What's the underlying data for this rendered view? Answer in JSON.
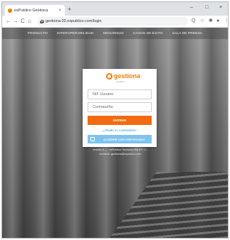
{
  "browser": {
    "tab_title": "esPublico Gestiona",
    "tab_close": "×",
    "new_tab": "+",
    "window_controls": {
      "minimize": "–",
      "maximize": "□",
      "close": "×"
    },
    "nav": {
      "back": "←",
      "forward": "→",
      "reload": "C",
      "home": "⌂"
    },
    "url": "gestiona-02.espublico.com/login",
    "toolbar_icons": {
      "search": "Q",
      "star": "☆",
      "extensions": "✱",
      "profile": "●",
      "menu": "⋮"
    }
  },
  "site_nav": [
    "PRODUCTO",
    "INTEROPERABILIDAD",
    "SEGURIDAD",
    "CASOS DE ÉXITO",
    "SALA DE PRENSA"
  ],
  "login": {
    "logo_text": "gestiona",
    "logo_sub": "espublico",
    "user_placeholder": "NIF Usuario",
    "password_placeholder": "Contraseña",
    "enter_label": "ENTRAR",
    "forgot_label": "¿Olvidó su contraseña?",
    "cert_label": "ACCEDER CON CERTIFICADO"
  },
  "footer": {
    "line1": "Versión 4.... · esPublico Servicios 900 877 0...",
    "line2": "contacto: gestiona@espublico.com"
  },
  "colors": {
    "brand_orange": "#f26b12",
    "cert_blue": "#7ec3ee",
    "link_blue": "#2f8fd8"
  }
}
